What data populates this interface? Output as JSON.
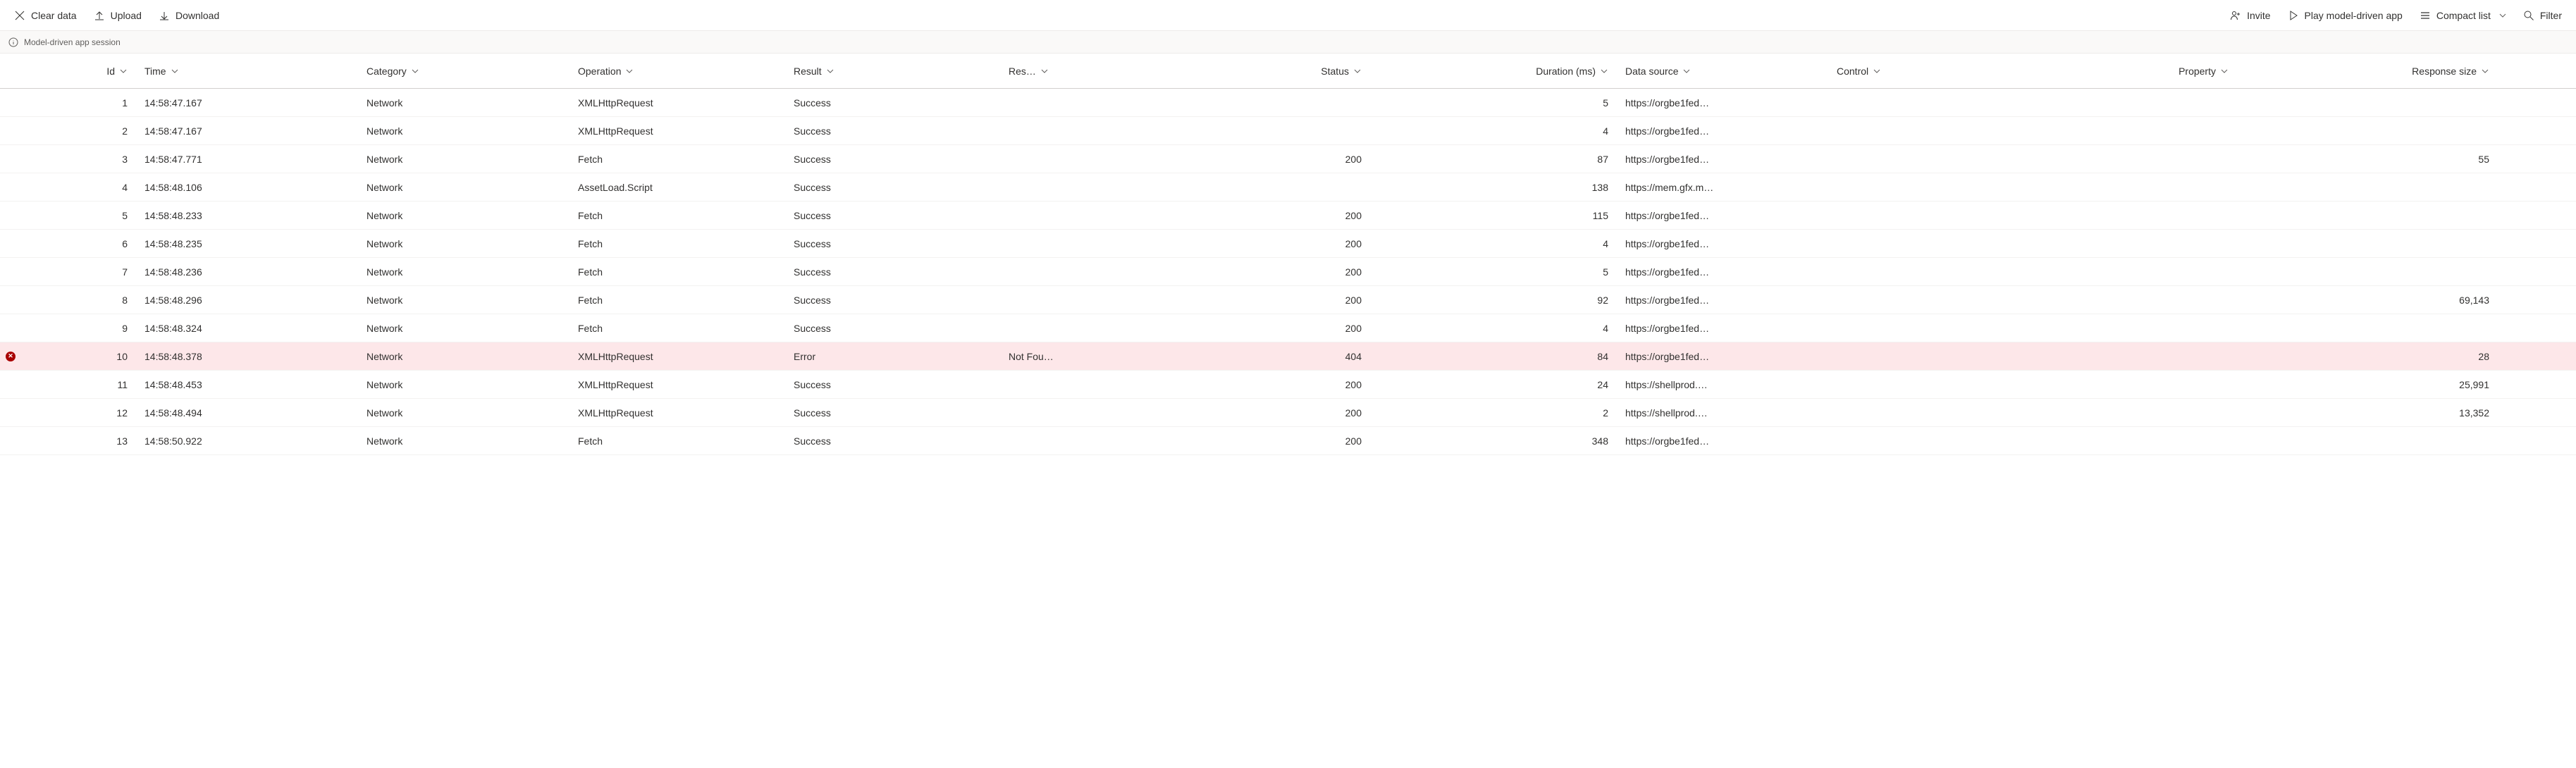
{
  "toolbar": {
    "clear_data": "Clear data",
    "upload": "Upload",
    "download": "Download",
    "invite": "Invite",
    "play_app": "Play model-driven app",
    "compact_list": "Compact list",
    "filter": "Filter"
  },
  "info_bar": {
    "session_label": "Model-driven app session"
  },
  "columns": {
    "id": "Id",
    "time": "Time",
    "category": "Category",
    "operation": "Operation",
    "result": "Result",
    "res": "Res…",
    "status": "Status",
    "duration": "Duration (ms)",
    "data_source": "Data source",
    "control": "Control",
    "property": "Property",
    "response_size": "Response size"
  },
  "rows": [
    {
      "id": "1",
      "time": "14:58:47.167",
      "category": "Network",
      "operation": "XMLHttpRequest",
      "result": "Success",
      "res": "",
      "status": "",
      "duration": "5",
      "data_source": "https://orgbe1fed…",
      "control": "",
      "property": "",
      "response_size": "",
      "error": false
    },
    {
      "id": "2",
      "time": "14:58:47.167",
      "category": "Network",
      "operation": "XMLHttpRequest",
      "result": "Success",
      "res": "",
      "status": "",
      "duration": "4",
      "data_source": "https://orgbe1fed…",
      "control": "",
      "property": "",
      "response_size": "",
      "error": false
    },
    {
      "id": "3",
      "time": "14:58:47.771",
      "category": "Network",
      "operation": "Fetch",
      "result": "Success",
      "res": "",
      "status": "200",
      "duration": "87",
      "data_source": "https://orgbe1fed…",
      "control": "",
      "property": "",
      "response_size": "55",
      "error": false
    },
    {
      "id": "4",
      "time": "14:58:48.106",
      "category": "Network",
      "operation": "AssetLoad.Script",
      "result": "Success",
      "res": "",
      "status": "",
      "duration": "138",
      "data_source": "https://mem.gfx.m…",
      "control": "",
      "property": "",
      "response_size": "",
      "error": false
    },
    {
      "id": "5",
      "time": "14:58:48.233",
      "category": "Network",
      "operation": "Fetch",
      "result": "Success",
      "res": "",
      "status": "200",
      "duration": "115",
      "data_source": "https://orgbe1fed…",
      "control": "",
      "property": "",
      "response_size": "",
      "error": false
    },
    {
      "id": "6",
      "time": "14:58:48.235",
      "category": "Network",
      "operation": "Fetch",
      "result": "Success",
      "res": "",
      "status": "200",
      "duration": "4",
      "data_source": "https://orgbe1fed…",
      "control": "",
      "property": "",
      "response_size": "",
      "error": false
    },
    {
      "id": "7",
      "time": "14:58:48.236",
      "category": "Network",
      "operation": "Fetch",
      "result": "Success",
      "res": "",
      "status": "200",
      "duration": "5",
      "data_source": "https://orgbe1fed…",
      "control": "",
      "property": "",
      "response_size": "",
      "error": false
    },
    {
      "id": "8",
      "time": "14:58:48.296",
      "category": "Network",
      "operation": "Fetch",
      "result": "Success",
      "res": "",
      "status": "200",
      "duration": "92",
      "data_source": "https://orgbe1fed…",
      "control": "",
      "property": "",
      "response_size": "69,143",
      "error": false
    },
    {
      "id": "9",
      "time": "14:58:48.324",
      "category": "Network",
      "operation": "Fetch",
      "result": "Success",
      "res": "",
      "status": "200",
      "duration": "4",
      "data_source": "https://orgbe1fed…",
      "control": "",
      "property": "",
      "response_size": "",
      "error": false
    },
    {
      "id": "10",
      "time": "14:58:48.378",
      "category": "Network",
      "operation": "XMLHttpRequest",
      "result": "Error",
      "res": "Not Fou…",
      "status": "404",
      "duration": "84",
      "data_source": "https://orgbe1fed…",
      "control": "",
      "property": "",
      "response_size": "28",
      "error": true
    },
    {
      "id": "11",
      "time": "14:58:48.453",
      "category": "Network",
      "operation": "XMLHttpRequest",
      "result": "Success",
      "res": "",
      "status": "200",
      "duration": "24",
      "data_source": "https://shellprod.…",
      "control": "",
      "property": "",
      "response_size": "25,991",
      "error": false
    },
    {
      "id": "12",
      "time": "14:58:48.494",
      "category": "Network",
      "operation": "XMLHttpRequest",
      "result": "Success",
      "res": "",
      "status": "200",
      "duration": "2",
      "data_source": "https://shellprod.…",
      "control": "",
      "property": "",
      "response_size": "13,352",
      "error": false
    },
    {
      "id": "13",
      "time": "14:58:50.922",
      "category": "Network",
      "operation": "Fetch",
      "result": "Success",
      "res": "",
      "status": "200",
      "duration": "348",
      "data_source": "https://orgbe1fed…",
      "control": "",
      "property": "",
      "response_size": "",
      "error": false
    }
  ]
}
